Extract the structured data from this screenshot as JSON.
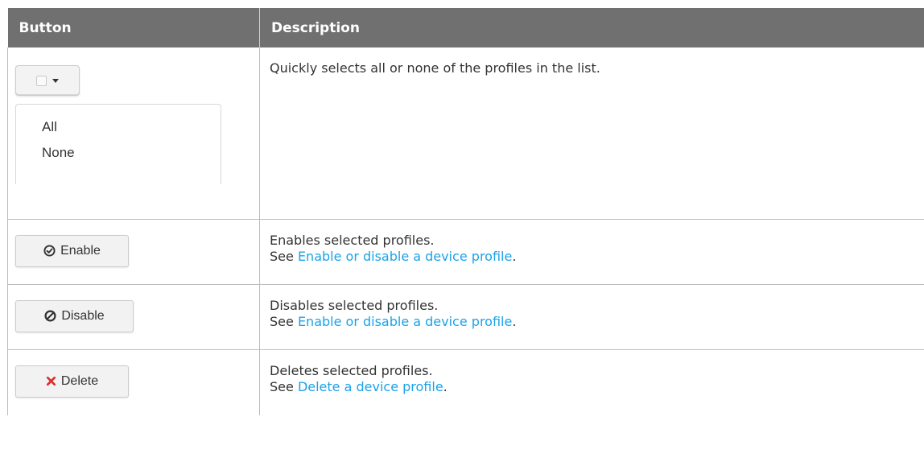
{
  "table": {
    "headers": {
      "button": "Button",
      "description": "Description"
    },
    "rows": [
      {
        "widget": {
          "type": "select-dropdown",
          "checkbox_icon": "checkbox-icon",
          "caret_icon": "caret-down-icon",
          "options": [
            "All",
            "None"
          ]
        },
        "description": "Quickly selects all or none of the profiles in the list.",
        "see_prefix": "",
        "link_text": "",
        "see_suffix": ""
      },
      {
        "widget": {
          "type": "button",
          "icon": "check-circle-icon",
          "icon_glyph": "⊘",
          "label": "Enable"
        },
        "description": "Enables selected profiles.",
        "see_prefix": "See ",
        "link_text": "Enable or disable a device profile",
        "see_suffix": "."
      },
      {
        "widget": {
          "type": "button",
          "icon": "ban-icon",
          "icon_glyph": "⊘",
          "label": "Disable"
        },
        "description": "Disables selected profiles.",
        "see_prefix": "See ",
        "link_text": "Enable or disable a device profile",
        "see_suffix": "."
      },
      {
        "widget": {
          "type": "button",
          "icon": "close-x-icon",
          "icon_glyph": "✖",
          "label": "Delete"
        },
        "description": "Deletes selected profiles.",
        "see_prefix": "See ",
        "link_text": "Delete a device profile",
        "see_suffix": "."
      }
    ]
  },
  "colors": {
    "header_bg": "#707070",
    "header_text": "#ffffff",
    "link": "#1aa3e8",
    "delete_icon": "#d9322e"
  }
}
